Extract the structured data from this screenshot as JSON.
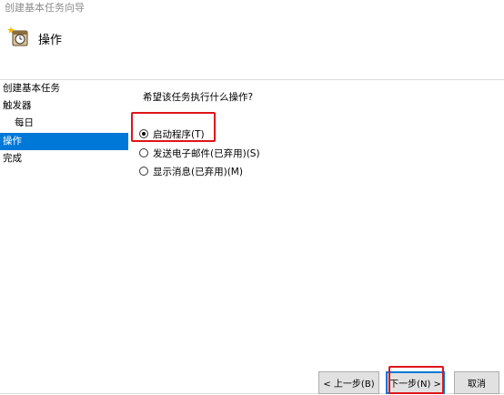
{
  "window": {
    "title": "创建基本任务向导"
  },
  "header": {
    "title": "操作",
    "icon": "task-scheduler-icon"
  },
  "sidebar": {
    "items": [
      {
        "label": "创建基本任务",
        "selected": false
      },
      {
        "label": "触发器",
        "selected": false
      },
      {
        "label": "每日",
        "selected": false
      },
      {
        "label": "操作",
        "selected": true
      },
      {
        "label": "完成",
        "selected": false
      }
    ]
  },
  "main": {
    "question": "希望该任务执行什么操作?",
    "options": [
      {
        "label": "启动程序(T)",
        "checked": true
      },
      {
        "label": "发送电子邮件(已弃用)(S)",
        "checked": false
      },
      {
        "label": "显示消息(已弃用)(M)",
        "checked": false
      }
    ]
  },
  "buttons": {
    "back": "< 上一步(B)",
    "next": "下一步(N) >",
    "cancel": "取消"
  },
  "colors": {
    "selection": "#0078d7",
    "annotation": "#e0151a"
  }
}
